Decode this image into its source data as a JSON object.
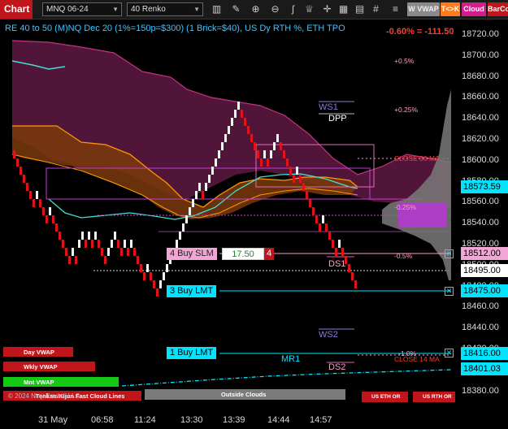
{
  "toolbar": {
    "chart_tab": "Chart",
    "instrument": "MNQ 06-24",
    "bar_type": "40 Renko",
    "buttons": {
      "vwap": "W VWAP",
      "tk": "T<>K",
      "cloud": "Cloud",
      "barcolor": "BarCo"
    }
  },
  "header": {
    "info": "RE 40 to 50 (M)NQ Dec 20 (1%=150p=$300) (1 Brick=$40), US Dy RTH %, ETH TPO",
    "pnl": "-0.60% = -111.50"
  },
  "yaxis": {
    "ticks": [
      "18720.00",
      "18700.00",
      "18680.00",
      "18660.00",
      "18640.00",
      "18620.00",
      "18600.00",
      "18580.00",
      "18560.00",
      "18540.00",
      "18520.00",
      "18500.00",
      "18480.00",
      "18460.00",
      "18440.00",
      "18420.00",
      "18400.00",
      "18380.00"
    ],
    "tags": {
      "last": "18573.59",
      "stop": "18512.00",
      "close": "18495.00",
      "limit3": "18475.00",
      "limit1": "18416.00",
      "mr1": "18401.03"
    }
  },
  "xaxis": {
    "ticks": [
      "31 May",
      "06:58",
      "11:24",
      "13:30",
      "13:39",
      "14:44",
      "14:57"
    ]
  },
  "levels": {
    "p05": "+0.5%",
    "p025": "+0.25%",
    "close30": "CLOSE 30 MA",
    "p025b": "-0.25%",
    "m05": "-0.5%",
    "m10": "-1.0%",
    "close14": "CLOSE 14 MA"
  },
  "pivots": {
    "ws1": "WS1",
    "dpp": "DPP",
    "ds1": "DS1",
    "ws2": "WS2",
    "mr1": "MR1",
    "ds2": "DS2"
  },
  "orders": {
    "buy_slm_label": "4 Buy SLM",
    "buy_slm_price": "17.50",
    "buy_slm_qty": "4",
    "buy_lmt3": "3 Buy LMT",
    "buy_lmt1": "1 Buy LMT"
  },
  "bottom_buttons": {
    "day_vwap": "Day VWAP",
    "wkly_vwap": "Wkly VWAP",
    "mnt_vwap": "Mnt VWAP",
    "tenkan": "Tenkan-Kijun Fast Cloud Lines",
    "outside": "Outside Clouds",
    "us_eth": "US ETH OR",
    "us_rth": "US RTH OR"
  },
  "copyright": "© 2024 NinjaTrader, LLC",
  "colors": {
    "accent_red": "#c0151b",
    "cyan": "#00e5ff",
    "magenta": "#c33ad6",
    "orange": "#ff9500"
  }
}
